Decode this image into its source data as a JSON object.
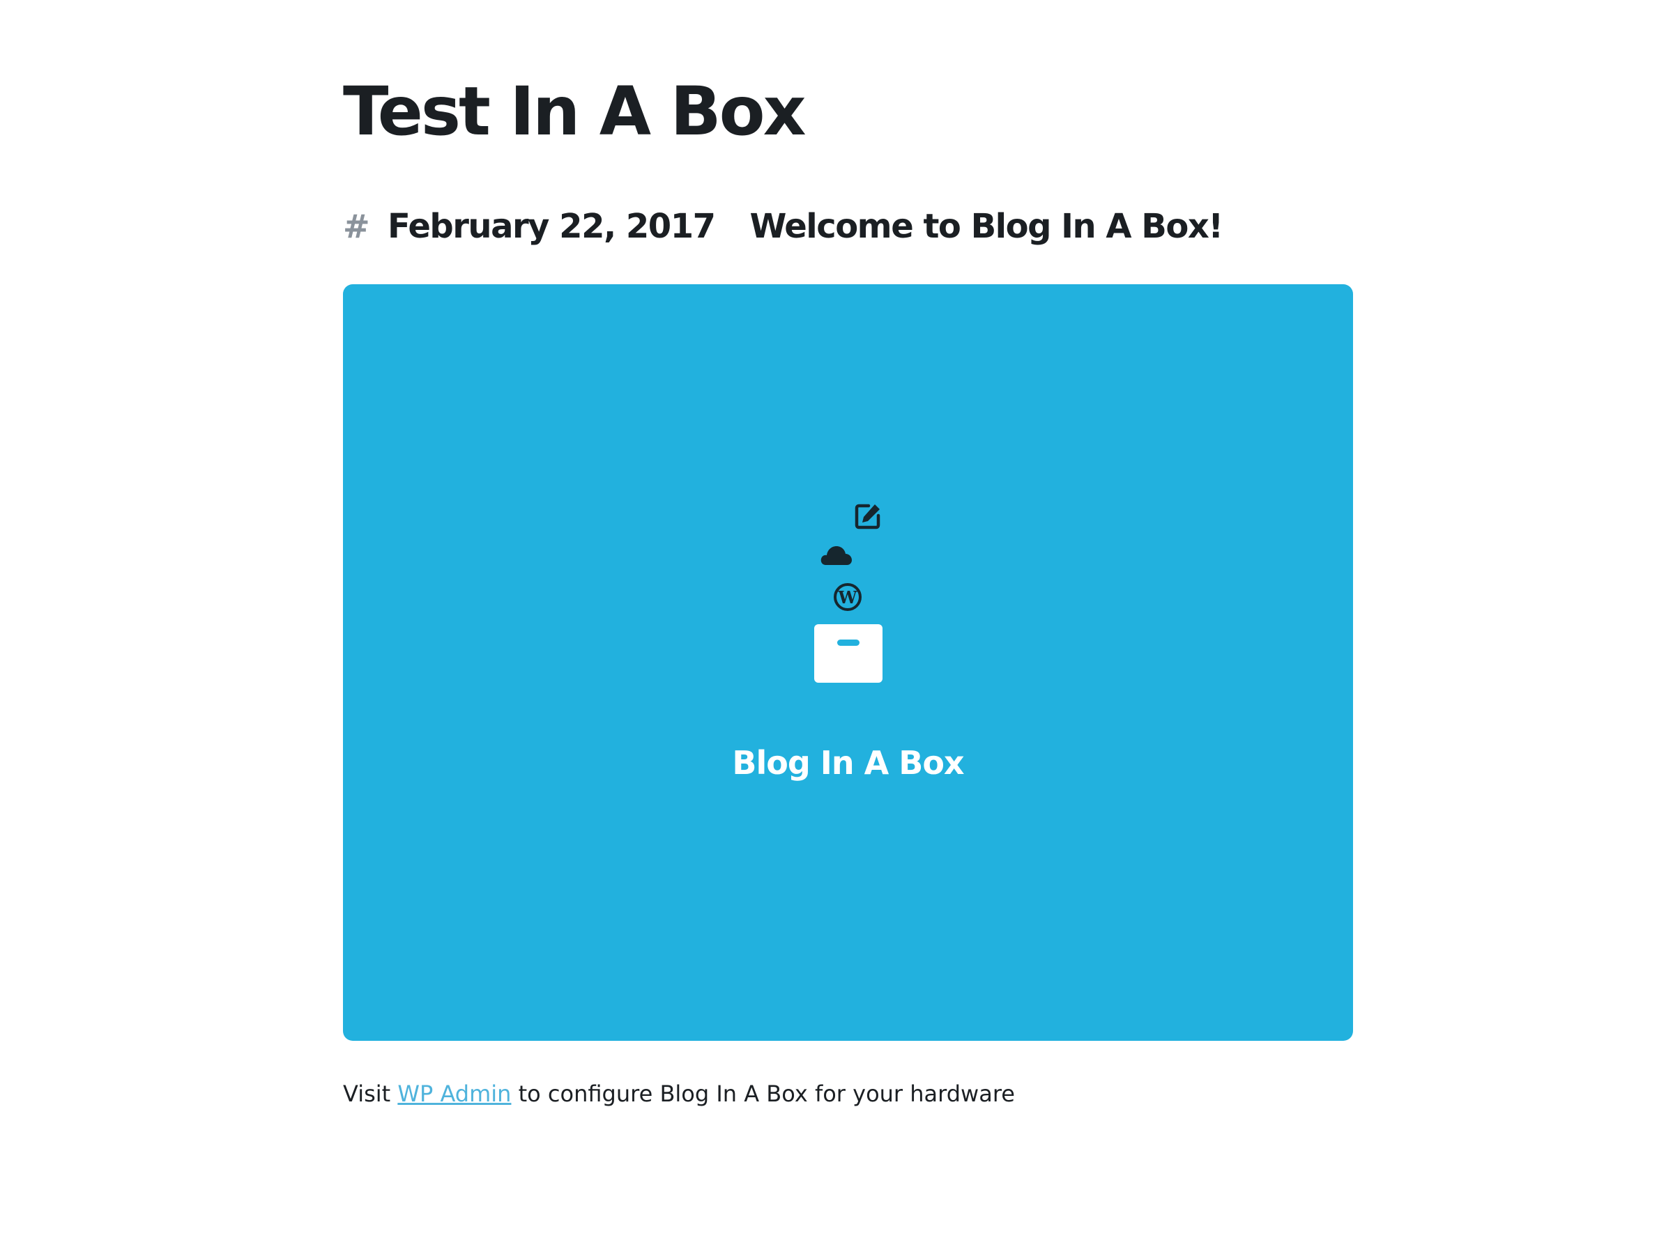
{
  "site": {
    "title": "Test In A Box"
  },
  "post": {
    "hash_icon": "hash-icon",
    "date": "February 22, 2017",
    "title": "Welcome to Blog In A Box!"
  },
  "hero": {
    "background": "#22b1de",
    "title": "Blog In A Box",
    "icons": [
      "edit-icon",
      "cloud-icon",
      "wordpress-icon",
      "box-icon"
    ]
  },
  "footer": {
    "prefix": "Visit ",
    "link_label": "WP Admin",
    "suffix": " to configure Blog In A Box for your hardware",
    "link_color": "#4fb3dc"
  }
}
